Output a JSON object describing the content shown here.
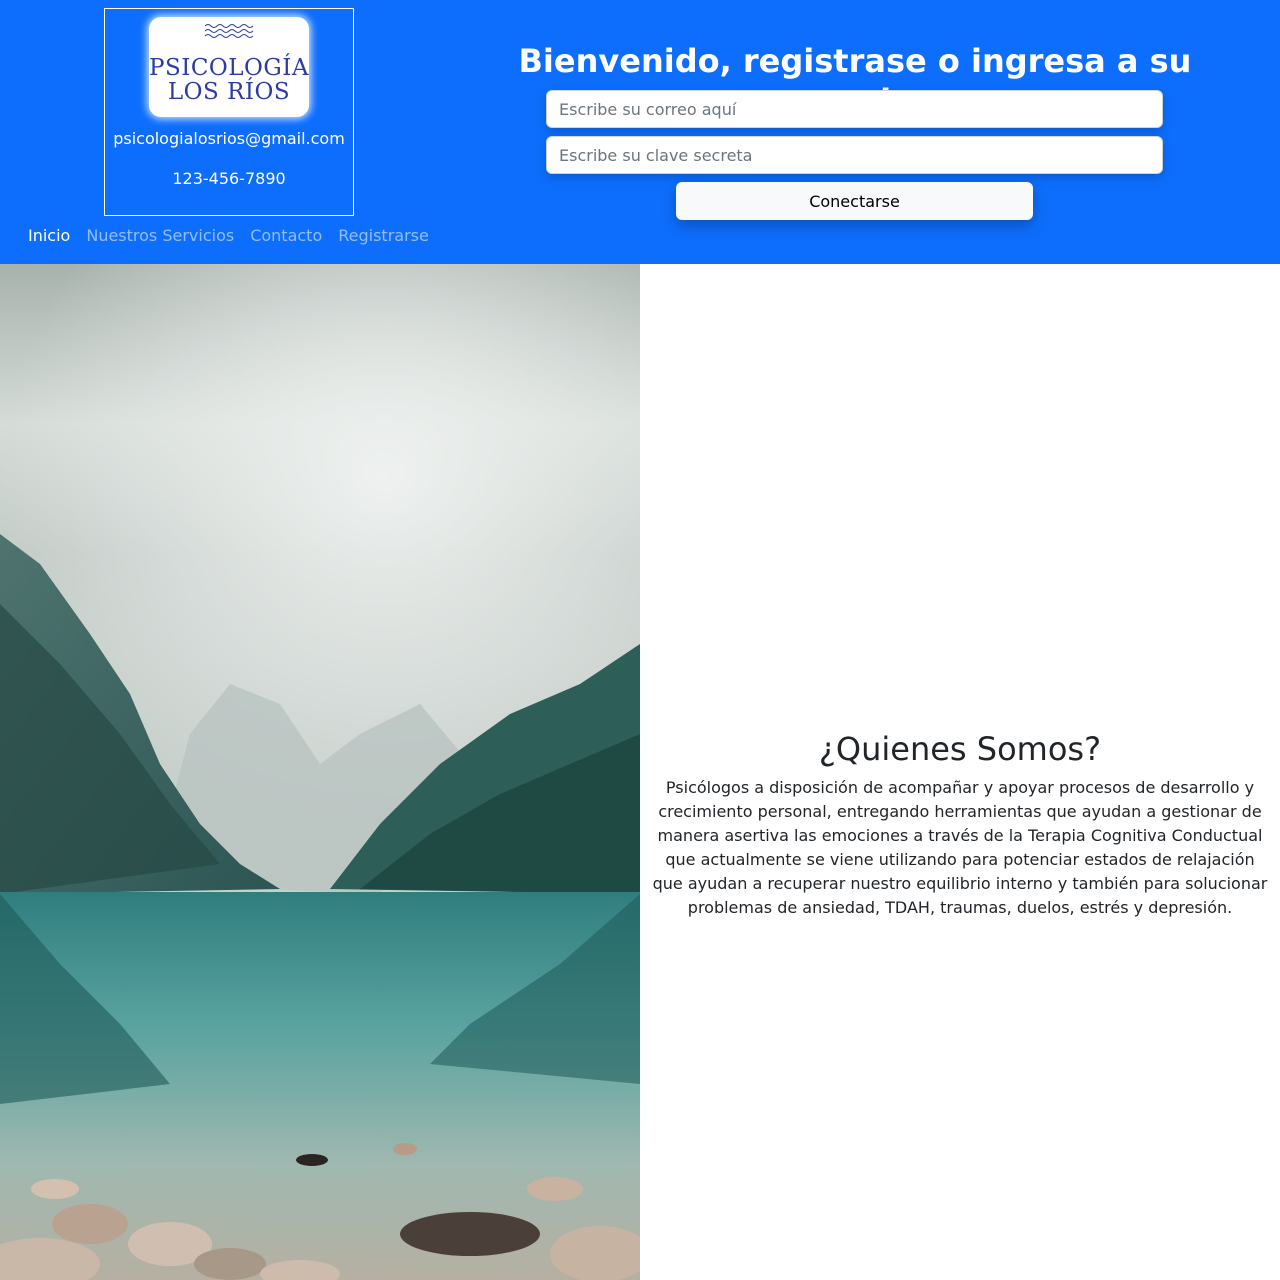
{
  "brand": {
    "logo_line1": "PSICOLOGÍA",
    "logo_line2": "LOS RÍOS",
    "email": "psicologialosrios@gmail.com",
    "phone": "123-456-7890"
  },
  "nav": {
    "items": [
      {
        "label": "Inicio",
        "active": true
      },
      {
        "label": "Nuestros Servicios",
        "active": false
      },
      {
        "label": "Contacto",
        "active": false
      },
      {
        "label": "Registrarse",
        "active": false
      }
    ]
  },
  "login": {
    "title": "Bienvenido, registrase o ingresa a su cuenta",
    "email_placeholder": "Escribe su correo aquí",
    "password_placeholder": "Escribe su clave secreta",
    "submit_label": "Conectarse"
  },
  "about": {
    "title": "¿Quienes Somos?",
    "text": "Psicólogos a disposición de acompañar y apoyar procesos de desarrollo y crecimiento personal, entregando herramientas que ayudan a gestionar de manera asertiva las emociones a través de la Terapia Cognitiva Conductual que actualmente se viene utilizando para potenciar estados de relajación que ayudan a recuperar nuestro equilibrio interno y también para solucionar problemas de ansiedad, TDAH, traumas, duelos, estrés y depresión."
  },
  "colors": {
    "header_bg": "#0d6efd",
    "logo_text": "#2b3aa8"
  }
}
